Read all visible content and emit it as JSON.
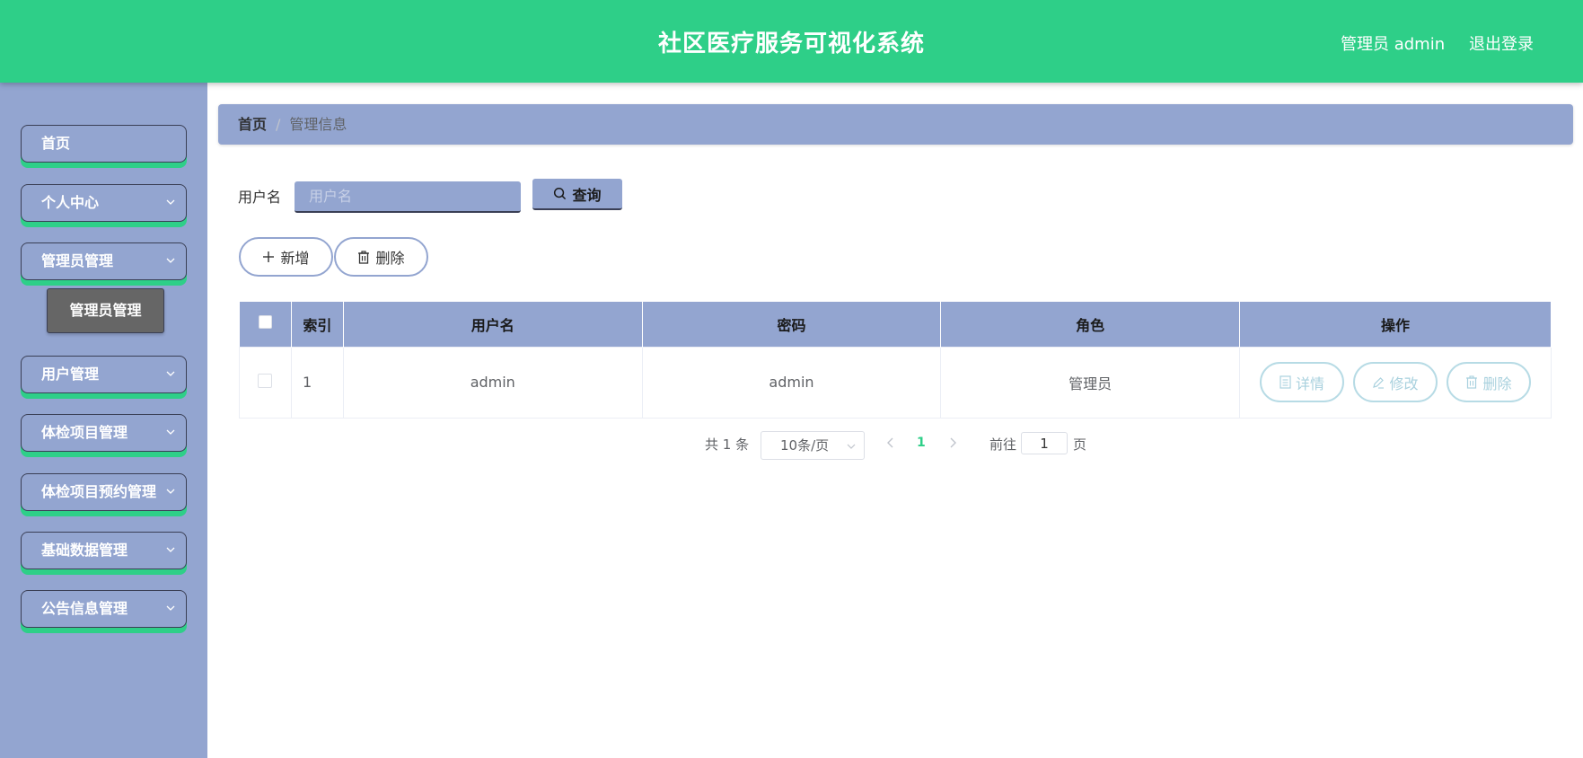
{
  "header": {
    "title": "社区医疗服务可视化系统",
    "user": "管理员 admin",
    "logout": "退出登录"
  },
  "sidebar": {
    "items": [
      {
        "label": "首页",
        "expandable": false
      },
      {
        "label": "个人中心",
        "expandable": true
      },
      {
        "label": "管理员管理",
        "expandable": true,
        "expanded": true
      },
      {
        "label": "用户管理",
        "expandable": true
      },
      {
        "label": "体检项目管理",
        "expandable": true
      },
      {
        "label": "体检项目预约管理",
        "expandable": true
      },
      {
        "label": "基础数据管理",
        "expandable": true
      },
      {
        "label": "公告信息管理",
        "expandable": true
      }
    ],
    "submenu": {
      "label": "管理员管理"
    }
  },
  "breadcrumb": {
    "home": "首页",
    "separator": "/",
    "current": "管理信息"
  },
  "search": {
    "label": "用户名",
    "placeholder": "用户名",
    "query_button": "查询"
  },
  "actions": {
    "add": "新增",
    "delete": "删除"
  },
  "table": {
    "columns": {
      "index": "索引",
      "username": "用户名",
      "password": "密码",
      "role": "角色",
      "actions": "操作"
    },
    "rows": [
      {
        "index": "1",
        "username": "admin",
        "password": "admin",
        "role": "管理员"
      }
    ],
    "row_actions": {
      "detail": "详情",
      "edit": "修改",
      "delete": "删除"
    }
  },
  "pagination": {
    "total": "共 1 条",
    "page_size": "10条/页",
    "current_page": "1",
    "goto_label": "前往",
    "goto_value": "1",
    "goto_unit": "页"
  },
  "colors": {
    "header_bg": "#2ecf88",
    "sidebar_bg": "#93a5d0",
    "accent": "#2ecf88",
    "submenu_bg": "#666666"
  }
}
